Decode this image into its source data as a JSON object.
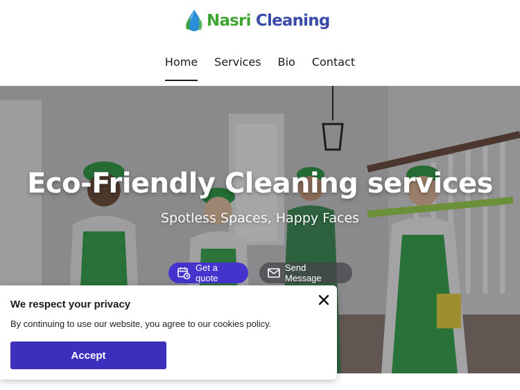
{
  "brand": {
    "name_part1": "Nasri",
    "name_part2": "Cleaning",
    "logo_icon": "water-drop-leaf-icon"
  },
  "nav": {
    "items": [
      {
        "label": "Home",
        "active": true
      },
      {
        "label": "Services",
        "active": false
      },
      {
        "label": "Bio",
        "active": false
      },
      {
        "label": "Contact",
        "active": false
      }
    ]
  },
  "hero": {
    "title": "Eco-Friendly Cleaning services",
    "subtitle": "Spotless Spaces, Happy Faces",
    "primary_button": {
      "label": "Get a quote",
      "icon": "calendar-clock-icon"
    },
    "secondary_button": {
      "label": "Send Message",
      "icon": "envelope-icon"
    }
  },
  "privacy": {
    "title": "We respect your privacy",
    "text": "By continuing to use our website, you agree to our cookies policy.",
    "accept_label": "Accept",
    "close_icon": "close-icon"
  },
  "colors": {
    "brand_green": "#3fa535",
    "brand_blue": "#3a4aa8",
    "primary_button": "#4433cc",
    "accept_button": "#3d2fbd"
  }
}
